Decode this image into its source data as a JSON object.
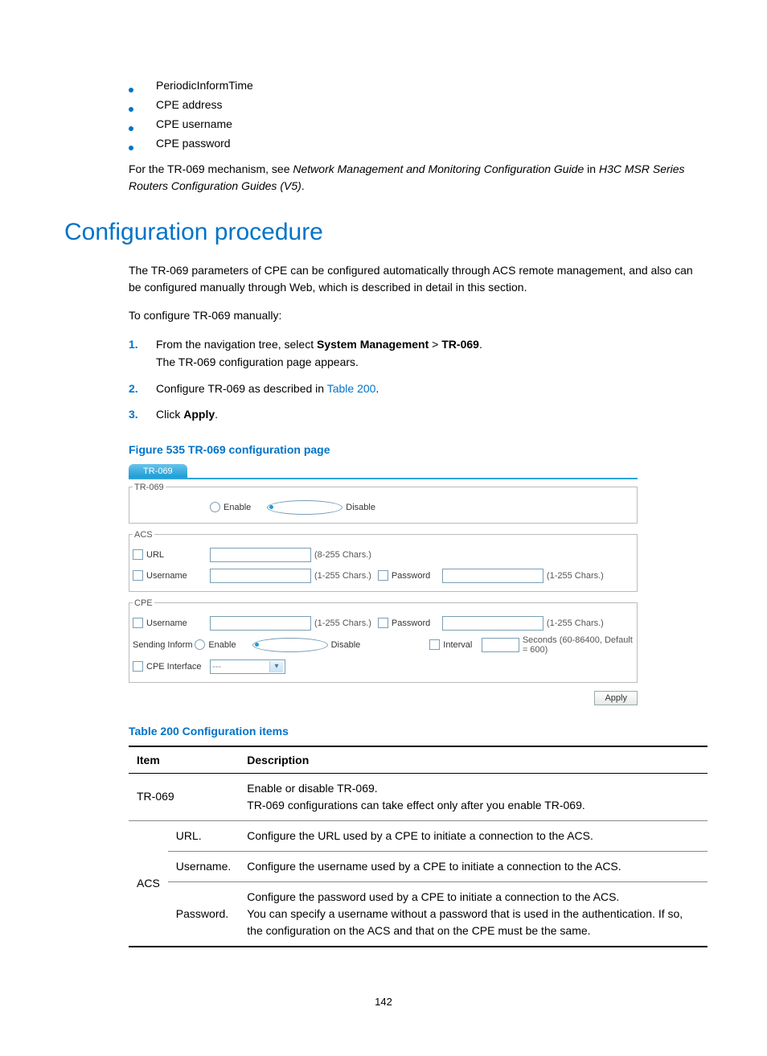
{
  "bullets": [
    "PeriodicInformTime",
    "CPE address",
    "CPE username",
    "CPE password"
  ],
  "intro_para": {
    "prefix": "For the TR-069 mechanism, see ",
    "italic1": "Network Management and Monitoring Configuration Guide",
    "mid": " in ",
    "italic2": "H3C MSR Series Routers Configuration Guides (V5)",
    "suffix": "."
  },
  "heading": "Configuration procedure",
  "para2": "The TR-069 parameters of CPE can be configured automatically through ACS remote management, and also can be configured manually through Web, which is described in detail in this section.",
  "para3": "To configure TR-069 manually:",
  "steps": [
    {
      "n": "1.",
      "pre": "From the navigation tree, select ",
      "b1": "System Management",
      "mid": " > ",
      "b2": "TR-069",
      "post": ".",
      "line2": "The TR-069 configuration page appears."
    },
    {
      "n": "2.",
      "pre": "Configure TR-069 as described in ",
      "link": "Table 200",
      "post": "."
    },
    {
      "n": "3.",
      "pre": "Click ",
      "b1": "Apply",
      "post": "."
    }
  ],
  "fig_caption": "Figure 535 TR-069 configuration page",
  "shot": {
    "tab": "TR-069",
    "group1": {
      "legend": "TR-069",
      "enable": "Enable",
      "disable": "Disable"
    },
    "group2": {
      "legend": "ACS",
      "url_label": "URL",
      "url_hint": "(8-255 Chars.)",
      "user_label": "Username",
      "user_hint": "(1-255 Chars.)",
      "pass_label": "Password",
      "pass_hint": "(1-255 Chars.)"
    },
    "group3": {
      "legend": "CPE",
      "user_label": "Username",
      "user_hint": "(1-255 Chars.)",
      "pass_label": "Password",
      "pass_hint": "(1-255 Chars.)",
      "sending": "Sending Inform",
      "enable": "Enable",
      "disable": "Disable",
      "interval": "Interval",
      "interval_hint": "Seconds (60-86400, Default = 600)",
      "iface": "CPE Interface",
      "iface_value": "---"
    },
    "apply": "Apply"
  },
  "table_caption": "Table 200 Configuration items",
  "table": {
    "headers": [
      "Item",
      "Description"
    ],
    "rows": [
      {
        "item": "TR-069",
        "subitem": "",
        "desc": "Enable or disable TR-069.\nTR-069 configurations can take effect only after you enable TR-069."
      },
      {
        "item": "",
        "subitem": "URL.",
        "desc": "Configure the URL used by a CPE to initiate a connection to the ACS."
      },
      {
        "item": "ACS",
        "subitem": "Username.",
        "desc": "Configure the username used by a CPE to initiate a connection to the ACS."
      },
      {
        "item": "",
        "subitem": "Password.",
        "desc": "Configure the password used by a CPE to initiate a connection to the ACS.\nYou can specify a username without a password that is used in the authentication. If so, the configuration on the ACS and that on the CPE must be the same."
      }
    ]
  },
  "page_number": "142"
}
